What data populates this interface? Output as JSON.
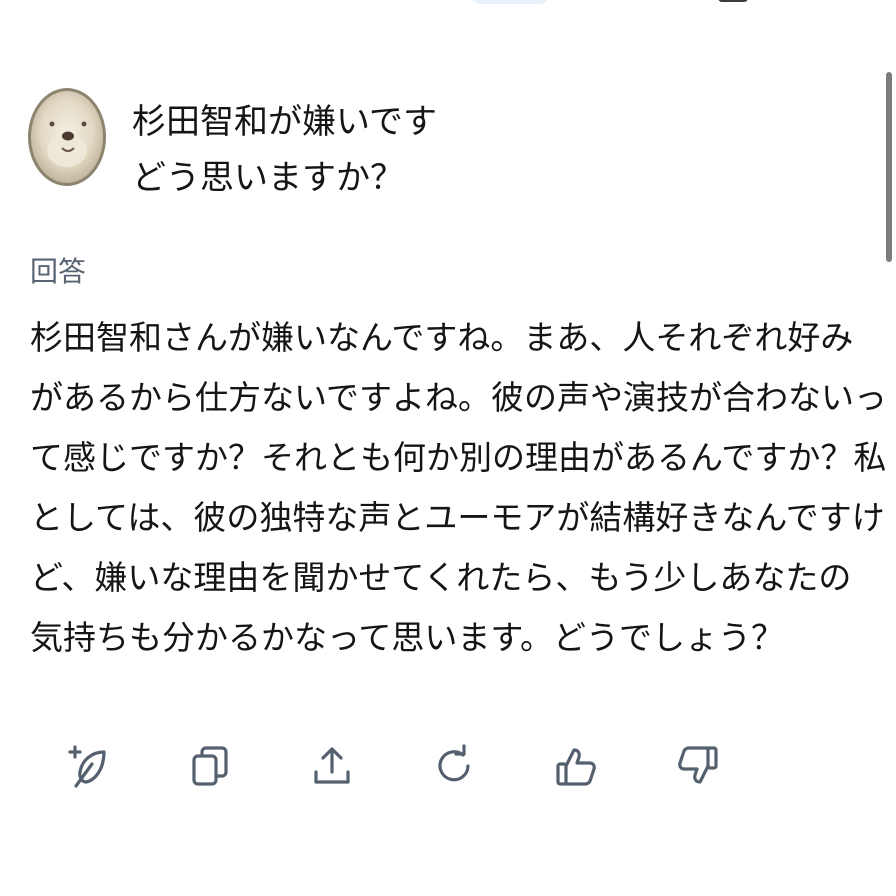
{
  "prompt": {
    "avatar_icon": "teddy-bear-avatar",
    "lines": [
      "杉田智和が嫌いです",
      "どう思いますか？"
    ]
  },
  "answer": {
    "label": "回答",
    "lines": [
      "杉田智和さんが嫌いなんですね。まあ、人それぞれ好み",
      "があるから仕方ないですよね。彼の声や演技が合わないっ",
      "て感じですか？それとも何か別の理由があるんですか？私",
      "としては、彼の独特な声とユーモアが結構好きなんですけ",
      "ど、嫌いな理由を聞かせてくれたら、もう少しあなたの",
      "気持ちも分かるかなって思います。どうでしょう？"
    ]
  },
  "actions": [
    {
      "icon": "quill-plus-icon"
    },
    {
      "icon": "copy-icon"
    },
    {
      "icon": "share-icon"
    },
    {
      "icon": "regenerate-icon"
    },
    {
      "icon": "thumbs-up-icon"
    },
    {
      "icon": "thumbs-down-icon"
    }
  ],
  "colors": {
    "text": "#151515",
    "label": "#586473",
    "icon": "#55606e",
    "background": "#ffffff"
  }
}
